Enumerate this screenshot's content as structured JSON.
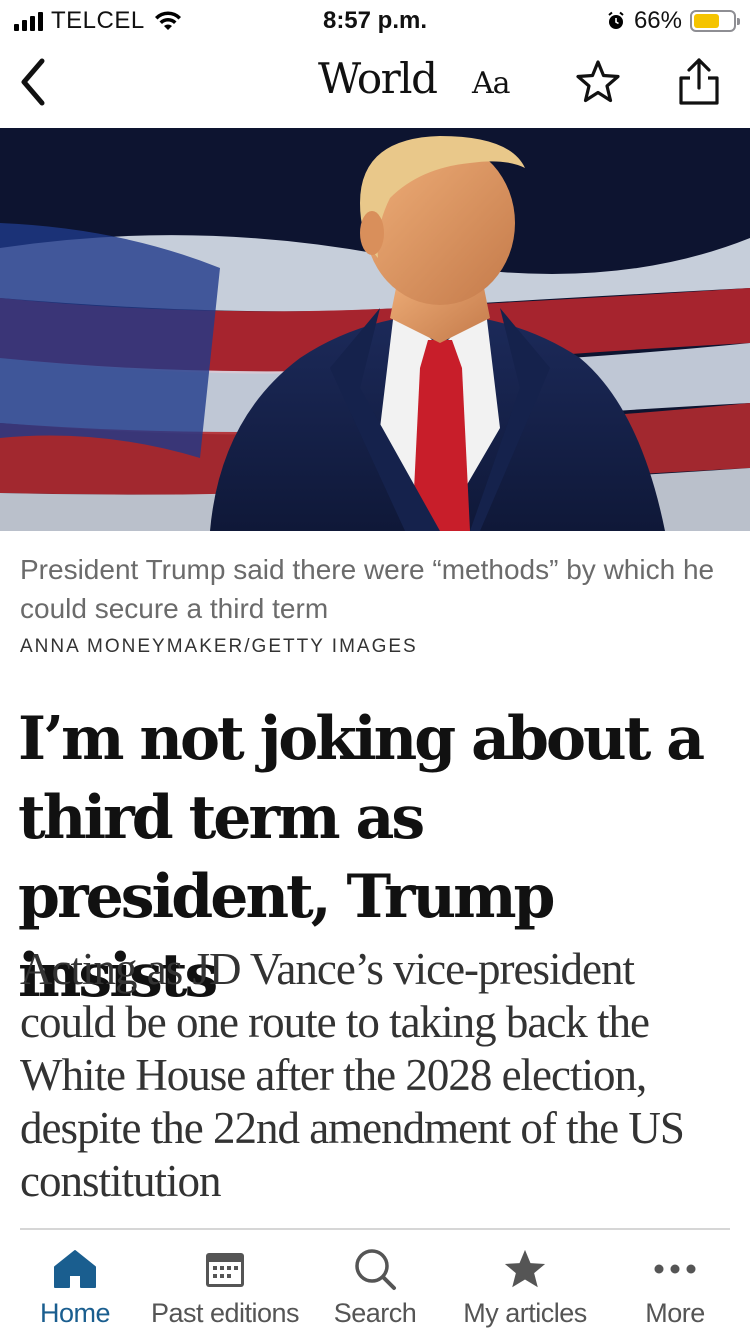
{
  "status_bar": {
    "carrier": "TELCEL",
    "time": "8:57 p.m.",
    "battery": "66%",
    "battery_level": 0.66
  },
  "nav": {
    "back_icon": "chevron-left-icon",
    "section_title": "World",
    "font_size_label": "Aa",
    "bookmark_icon": "star-icon",
    "share_icon": "share-icon"
  },
  "article": {
    "caption": "President Trump said there were “methods” by which he could secure a third term",
    "credit": "ANNA MONEYMAKER/GETTY IMAGES",
    "headline": "I’m not joking about a third term as president, Trump insists",
    "standfirst": "Acting as JD Vance’s vice-president could be one route to taking back the White House after the 2028 election, despite the 22nd amendment of the US constitution"
  },
  "tab_bar": {
    "tabs": [
      {
        "label": "Home",
        "icon": "home-icon",
        "active": true
      },
      {
        "label": "Past editions",
        "icon": "calendar-icon",
        "active": false
      },
      {
        "label": "Search",
        "icon": "search-icon",
        "active": false
      },
      {
        "label": "My articles",
        "icon": "star-filled-icon",
        "active": false
      },
      {
        "label": "More",
        "icon": "more-dots-icon",
        "active": false
      }
    ]
  },
  "colors": {
    "accent": "#1a5e8f",
    "battery": "#f5c400",
    "tab_inactive": "#555555"
  }
}
